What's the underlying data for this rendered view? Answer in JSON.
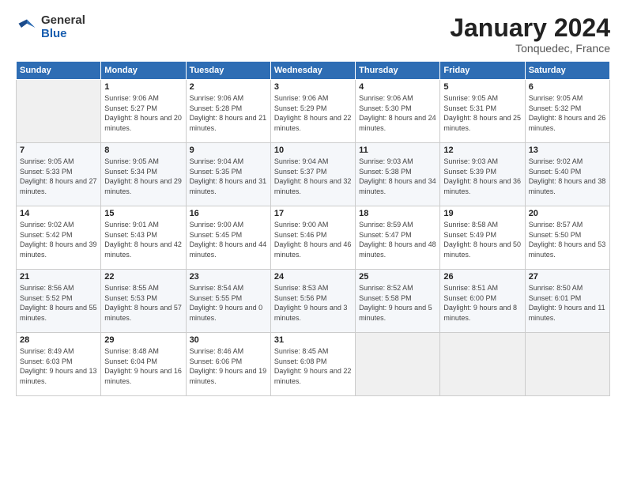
{
  "header": {
    "logo_general": "General",
    "logo_blue": "Blue",
    "month_title": "January 2024",
    "location": "Tonquedec, France"
  },
  "weekdays": [
    "Sunday",
    "Monday",
    "Tuesday",
    "Wednesday",
    "Thursday",
    "Friday",
    "Saturday"
  ],
  "weeks": [
    [
      {
        "num": "",
        "empty": true
      },
      {
        "num": "1",
        "sunrise": "9:06 AM",
        "sunset": "5:27 PM",
        "daylight": "8 hours and 20 minutes."
      },
      {
        "num": "2",
        "sunrise": "9:06 AM",
        "sunset": "5:28 PM",
        "daylight": "8 hours and 21 minutes."
      },
      {
        "num": "3",
        "sunrise": "9:06 AM",
        "sunset": "5:29 PM",
        "daylight": "8 hours and 22 minutes."
      },
      {
        "num": "4",
        "sunrise": "9:06 AM",
        "sunset": "5:30 PM",
        "daylight": "8 hours and 24 minutes."
      },
      {
        "num": "5",
        "sunrise": "9:05 AM",
        "sunset": "5:31 PM",
        "daylight": "8 hours and 25 minutes."
      },
      {
        "num": "6",
        "sunrise": "9:05 AM",
        "sunset": "5:32 PM",
        "daylight": "8 hours and 26 minutes."
      }
    ],
    [
      {
        "num": "7",
        "sunrise": "9:05 AM",
        "sunset": "5:33 PM",
        "daylight": "8 hours and 27 minutes."
      },
      {
        "num": "8",
        "sunrise": "9:05 AM",
        "sunset": "5:34 PM",
        "daylight": "8 hours and 29 minutes."
      },
      {
        "num": "9",
        "sunrise": "9:04 AM",
        "sunset": "5:35 PM",
        "daylight": "8 hours and 31 minutes."
      },
      {
        "num": "10",
        "sunrise": "9:04 AM",
        "sunset": "5:37 PM",
        "daylight": "8 hours and 32 minutes."
      },
      {
        "num": "11",
        "sunrise": "9:03 AM",
        "sunset": "5:38 PM",
        "daylight": "8 hours and 34 minutes."
      },
      {
        "num": "12",
        "sunrise": "9:03 AM",
        "sunset": "5:39 PM",
        "daylight": "8 hours and 36 minutes."
      },
      {
        "num": "13",
        "sunrise": "9:02 AM",
        "sunset": "5:40 PM",
        "daylight": "8 hours and 38 minutes."
      }
    ],
    [
      {
        "num": "14",
        "sunrise": "9:02 AM",
        "sunset": "5:42 PM",
        "daylight": "8 hours and 39 minutes."
      },
      {
        "num": "15",
        "sunrise": "9:01 AM",
        "sunset": "5:43 PM",
        "daylight": "8 hours and 42 minutes."
      },
      {
        "num": "16",
        "sunrise": "9:00 AM",
        "sunset": "5:45 PM",
        "daylight": "8 hours and 44 minutes."
      },
      {
        "num": "17",
        "sunrise": "9:00 AM",
        "sunset": "5:46 PM",
        "daylight": "8 hours and 46 minutes."
      },
      {
        "num": "18",
        "sunrise": "8:59 AM",
        "sunset": "5:47 PM",
        "daylight": "8 hours and 48 minutes."
      },
      {
        "num": "19",
        "sunrise": "8:58 AM",
        "sunset": "5:49 PM",
        "daylight": "8 hours and 50 minutes."
      },
      {
        "num": "20",
        "sunrise": "8:57 AM",
        "sunset": "5:50 PM",
        "daylight": "8 hours and 53 minutes."
      }
    ],
    [
      {
        "num": "21",
        "sunrise": "8:56 AM",
        "sunset": "5:52 PM",
        "daylight": "8 hours and 55 minutes."
      },
      {
        "num": "22",
        "sunrise": "8:55 AM",
        "sunset": "5:53 PM",
        "daylight": "8 hours and 57 minutes."
      },
      {
        "num": "23",
        "sunrise": "8:54 AM",
        "sunset": "5:55 PM",
        "daylight": "9 hours and 0 minutes."
      },
      {
        "num": "24",
        "sunrise": "8:53 AM",
        "sunset": "5:56 PM",
        "daylight": "9 hours and 3 minutes."
      },
      {
        "num": "25",
        "sunrise": "8:52 AM",
        "sunset": "5:58 PM",
        "daylight": "9 hours and 5 minutes."
      },
      {
        "num": "26",
        "sunrise": "8:51 AM",
        "sunset": "6:00 PM",
        "daylight": "9 hours and 8 minutes."
      },
      {
        "num": "27",
        "sunrise": "8:50 AM",
        "sunset": "6:01 PM",
        "daylight": "9 hours and 11 minutes."
      }
    ],
    [
      {
        "num": "28",
        "sunrise": "8:49 AM",
        "sunset": "6:03 PM",
        "daylight": "9 hours and 13 minutes."
      },
      {
        "num": "29",
        "sunrise": "8:48 AM",
        "sunset": "6:04 PM",
        "daylight": "9 hours and 16 minutes."
      },
      {
        "num": "30",
        "sunrise": "8:46 AM",
        "sunset": "6:06 PM",
        "daylight": "9 hours and 19 minutes."
      },
      {
        "num": "31",
        "sunrise": "8:45 AM",
        "sunset": "6:08 PM",
        "daylight": "9 hours and 22 minutes."
      },
      {
        "num": "",
        "empty": true
      },
      {
        "num": "",
        "empty": true
      },
      {
        "num": "",
        "empty": true
      }
    ]
  ]
}
